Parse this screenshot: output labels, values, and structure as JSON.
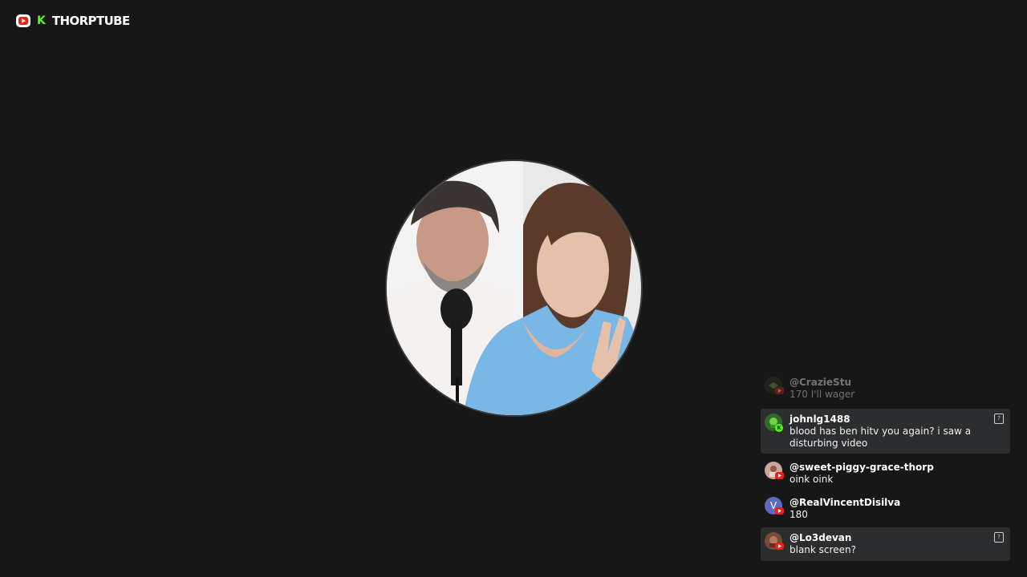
{
  "brand": {
    "name": "THORPTUBE",
    "kick_letter": "K"
  },
  "chat": {
    "messages": [
      {
        "user": "@CrazieStu",
        "text": "170 I'll wager",
        "platform": "youtube",
        "faded": true,
        "highlighted": false
      },
      {
        "user": "johnlg1488",
        "text": "blood has ben hitv you again? i saw a disturbing video",
        "platform": "kick",
        "faded": false,
        "highlighted": true
      },
      {
        "user": "@sweet-piggy-grace-thorp",
        "text": "oink oink",
        "platform": "youtube",
        "faded": false,
        "highlighted": false
      },
      {
        "user": "@RealVincentDisilva",
        "text": "180",
        "platform": "youtube",
        "avatar_letter": "V",
        "faded": false,
        "highlighted": false
      },
      {
        "user": "@Lo3devan",
        "text": "blank screen?",
        "platform": "youtube",
        "faded": false,
        "highlighted": true
      }
    ]
  },
  "colors": {
    "background": "#171717",
    "highlight": "#2b2d2f",
    "youtube_red": "#e62117",
    "kick_green": "#53fc18",
    "avatar_v": "#5c6bc0"
  },
  "icons": {
    "youtube": "youtube-icon",
    "kick": "kick-icon",
    "flag": "flag-icon"
  }
}
